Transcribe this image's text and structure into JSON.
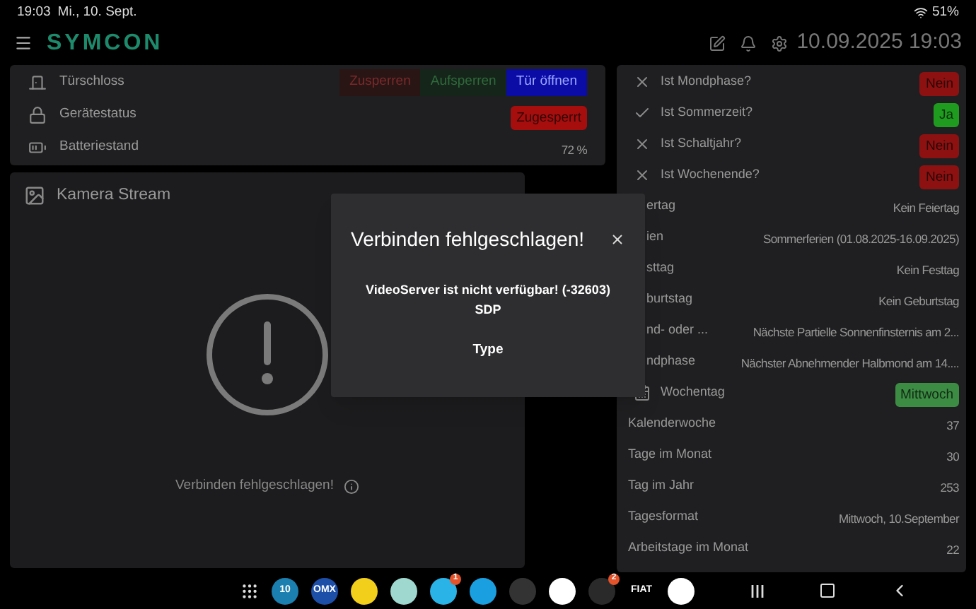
{
  "status_bar": {
    "time": "19:03",
    "date": "Mi., 10. Sept.",
    "battery": "51%"
  },
  "header": {
    "logo": "SYMCON",
    "datetime": "10.09.2025 19:03"
  },
  "lock_card": {
    "rows": [
      {
        "label": "Türschloss",
        "kind": "buttons",
        "buttons": [
          {
            "label": "Zusperren",
            "color": "#2a1515"
          },
          {
            "label": "Aufsperren",
            "color": "#152519"
          },
          {
            "label": "Tür öffnen",
            "color": "#0b0ba6"
          }
        ]
      },
      {
        "label": "Gerätestatus",
        "kind": "badge",
        "value": "Zugesperrt",
        "color": "#a60e0e"
      },
      {
        "label": "Batteriestand",
        "kind": "text",
        "value": "72 %"
      }
    ]
  },
  "camera_card": {
    "title": "Kamera Stream",
    "message": "Verbinden fehlgeschlagen!"
  },
  "dialog": {
    "title": "Verbinden fehlgeschlagen!",
    "lines": [
      "VideoServer ist nicht verfügbar! (-32603)",
      "SDP"
    ],
    "footer": "Type"
  },
  "info_card": {
    "rows": [
      {
        "label": "Ist Mondphase?",
        "kind": "flag",
        "on": false,
        "value": "Nein",
        "color": "#8e1111"
      },
      {
        "label": "Ist Sommerzeit?",
        "kind": "flag",
        "on": true,
        "value": "Ja",
        "color": "#1f9c1f"
      },
      {
        "label": "Ist Schaltjahr?",
        "kind": "flag",
        "on": false,
        "value": "Nein",
        "color": "#8e1111"
      },
      {
        "label": "Ist Wochenende?",
        "kind": "flag",
        "on": false,
        "value": "Nein",
        "color": "#8e1111"
      },
      {
        "label": "ertag",
        "covered": true,
        "kind": "text",
        "value": "Kein Feiertag"
      },
      {
        "label": "ien",
        "covered": true,
        "kind": "text",
        "value": "Sommerferien (01.08.2025-16.09.2025)"
      },
      {
        "label": "sttag",
        "covered": true,
        "kind": "text",
        "value": "Kein Festtag"
      },
      {
        "label": "burtstag",
        "covered": true,
        "kind": "text",
        "value": "Kein Geburtstag"
      },
      {
        "label": "nd- oder ...",
        "covered": true,
        "kind": "text",
        "value": "Nächste Partielle Sonnenfinsternis am 2..."
      },
      {
        "label": "ndphase",
        "covered": true,
        "kind": "text",
        "value": "Nächster Abnehmender Halbmond am 14...."
      },
      {
        "label": "Wochentag",
        "kind": "badge",
        "value": "Mittwoch",
        "color": "#3c8c44"
      },
      {
        "label": "Kalenderwoche",
        "kind": "text",
        "value": "37"
      },
      {
        "label": "Tage im Monat",
        "kind": "text",
        "value": "30"
      },
      {
        "label": "Tag im Jahr",
        "kind": "text",
        "value": "253"
      },
      {
        "label": "Tagesformat",
        "kind": "text",
        "value": "Mittwoch, 10.September"
      },
      {
        "label": "Arbeitstage im Monat",
        "kind": "text",
        "value": "22"
      }
    ]
  },
  "taskbar": {
    "apps": [
      {
        "label": "10",
        "color": "#1b7fb0"
      },
      {
        "label": "OMX",
        "color": "#1d4fa8"
      },
      {
        "color": "#f2cf1a"
      },
      {
        "color": "#9fd8cf"
      },
      {
        "color": "#2ab3e6",
        "badge": "1"
      },
      {
        "color": "#1aa0e0"
      },
      {
        "color": "#333333"
      },
      {
        "color": "#ffffff"
      },
      {
        "color": "#2a2a2a",
        "badge": "2"
      },
      {
        "label": "FIAT",
        "color": "#000000"
      },
      {
        "color": "#ffffff"
      }
    ]
  }
}
